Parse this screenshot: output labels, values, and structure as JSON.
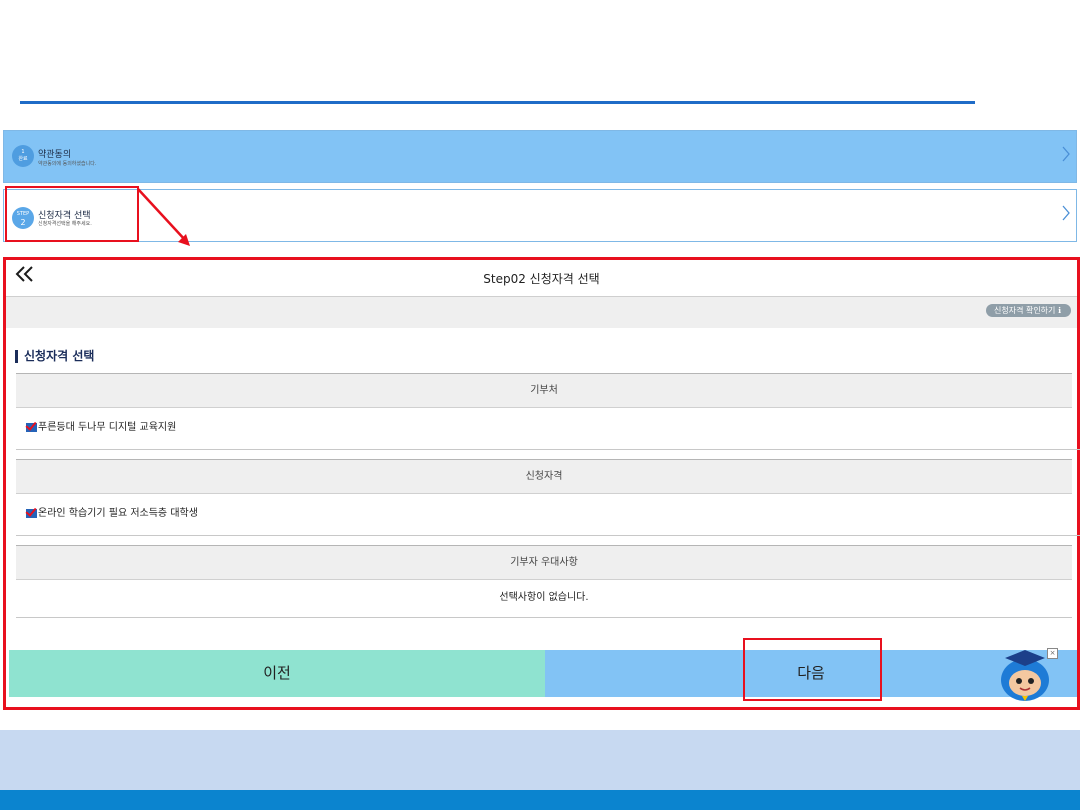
{
  "steps": [
    {
      "badge_top": "1",
      "badge_bottom": "완료",
      "title": "약관동의",
      "subtitle": "약관동의에 동의하셨습니다."
    },
    {
      "badge_top": "STEP",
      "badge_bottom": "2",
      "title": "신청자격 선택",
      "subtitle": "신청자격선택을 해주세요."
    }
  ],
  "panel": {
    "title": "Step02 신청자격 선택",
    "back_glyph": "≪",
    "confirm_button": "신청자격 확인하기 ℹ",
    "section_title": "신청자격 선택",
    "table": {
      "donor_header": "기부처",
      "donor_value": "푸른등대 두나무 디지털 교육지원",
      "qualification_header": "신청자격",
      "qualification_value": "온라인 학습기기 필요 저소득층 대학생",
      "preference_header": "기부자 우대사항",
      "preference_value": "선택사항이 없습니다."
    },
    "prev_button": "이전",
    "next_button": "다음"
  },
  "mascot": {
    "close_glyph": "×"
  },
  "colors": {
    "highlight_red": "#e8101e",
    "step_active_blue": "#82c3f5",
    "prev_button_mint": "#8fe3d0",
    "footer_blue": "#0b84cf",
    "footer_light": "#c7d9f1"
  }
}
